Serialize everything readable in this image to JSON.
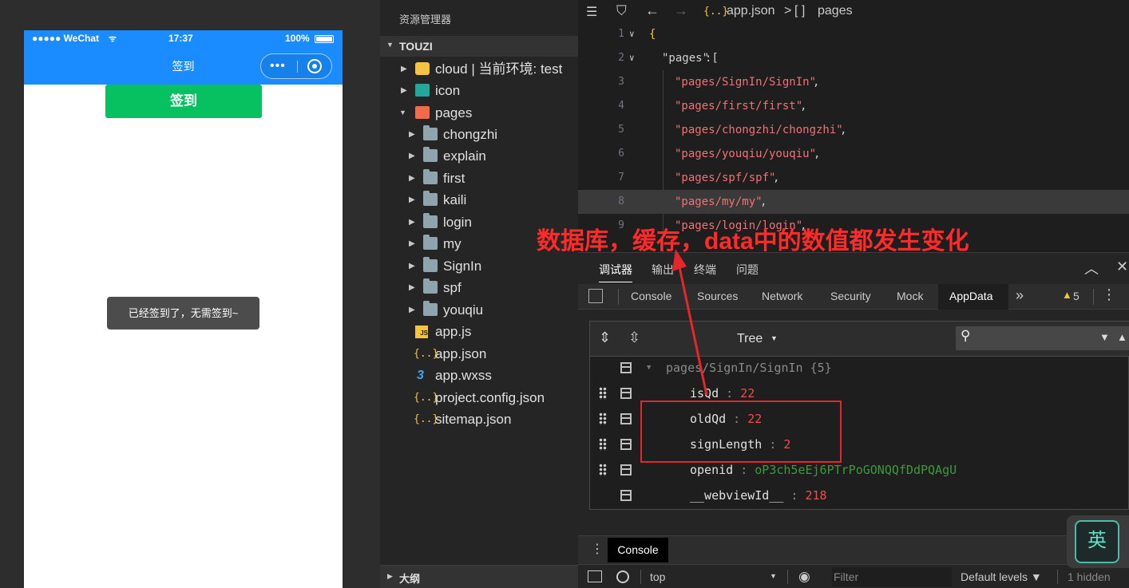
{
  "simulator": {
    "status": {
      "carrier": "●●●●● WeChat",
      "time": "17:37",
      "battery": "100%"
    },
    "nav_title": "签到",
    "signin_button": "签到",
    "toast": "已经签到了，无需签到~"
  },
  "explorer": {
    "title": "资源管理器",
    "project": "TOUZI",
    "items": [
      {
        "label": "cloud | 当前环境: test",
        "icon": "cloud-folder-icon"
      },
      {
        "label": "icon",
        "icon": "image-folder-icon"
      },
      {
        "label": "pages",
        "icon": "pages-folder-icon"
      },
      {
        "label": "chongzhi",
        "icon": "folder-icon"
      },
      {
        "label": "explain",
        "icon": "folder-icon"
      },
      {
        "label": "first",
        "icon": "folder-icon"
      },
      {
        "label": "kaili",
        "icon": "folder-icon"
      },
      {
        "label": "login",
        "icon": "folder-icon"
      },
      {
        "label": "my",
        "icon": "folder-icon"
      },
      {
        "label": "SignIn",
        "icon": "folder-icon"
      },
      {
        "label": "spf",
        "icon": "folder-icon"
      },
      {
        "label": "youqiu",
        "icon": "folder-icon"
      },
      {
        "label": "app.js",
        "icon": "js-file-icon"
      },
      {
        "label": "app.json",
        "icon": "json-file-icon"
      },
      {
        "label": "app.wxss",
        "icon": "css-file-icon"
      },
      {
        "label": "project.config.json",
        "icon": "json-file-icon"
      },
      {
        "label": "sitemap.json",
        "icon": "json-file-icon"
      }
    ],
    "outline": "大纲"
  },
  "editor": {
    "breadcrumb": {
      "file_icon": "{..}",
      "file": "app.json",
      "sep": ">",
      "node_icon": "[ ]",
      "node": "pages"
    },
    "lines": [
      {
        "n": "1",
        "text": "{"
      },
      {
        "n": "2",
        "key": "\"pages\"",
        "text": ":["
      },
      {
        "n": "3",
        "text": "\"pages/SignIn/SignIn\"",
        "tail": ","
      },
      {
        "n": "4",
        "text": "\"pages/first/first\"",
        "tail": ","
      },
      {
        "n": "5",
        "text": "\"pages/chongzhi/chongzhi\"",
        "tail": ","
      },
      {
        "n": "6",
        "text": "\"pages/youqiu/youqiu\"",
        "tail": ","
      },
      {
        "n": "7",
        "text": "\"pages/spf/spf\"",
        "tail": ","
      },
      {
        "n": "8",
        "text": "\"pages/my/my\"",
        "tail": ","
      },
      {
        "n": "9",
        "text": "\"pages/login/login\"",
        "tail": ","
      }
    ]
  },
  "devtools": {
    "top_tabs": [
      "调试器",
      "输出",
      "终端",
      "问题"
    ],
    "tabs": [
      "Console",
      "Sources",
      "Network",
      "Security",
      "Mock",
      "AppData"
    ],
    "active_tab": "AppData",
    "more": "»",
    "warnings": "5",
    "tree_label": "Tree",
    "appdata": {
      "path": "pages/SignIn/SignIn {5}",
      "rows": [
        {
          "key": "isQd",
          "value": "22",
          "type": "num"
        },
        {
          "key": "oldQd",
          "value": "22",
          "type": "num"
        },
        {
          "key": "signLength",
          "value": "2",
          "type": "num"
        },
        {
          "key": "openid",
          "value": "oP3ch5eEj6PTrPoGONQQfDdPQAgU",
          "type": "str"
        },
        {
          "key": "__webviewId__",
          "value": "218",
          "type": "num"
        }
      ]
    },
    "console_drawer_tab": "Console",
    "console_bar": {
      "context": "top",
      "filter_placeholder": "Filter",
      "levels": "Default levels ▼",
      "hidden": "1 hidden"
    }
  },
  "annotation": "数据库，缓存，data中的数值都发生变化",
  "ime": "英",
  "colors": {
    "accent": "#1a8cff",
    "wechat_green": "#07c160",
    "annotation_red": "#ff2a2a"
  }
}
